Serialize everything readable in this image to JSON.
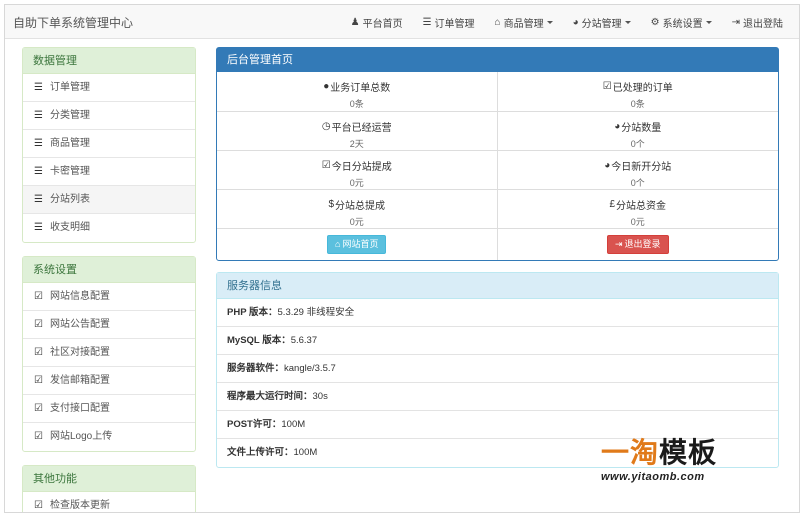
{
  "navbar": {
    "brand": "自助下单系统管理中心",
    "items": [
      {
        "label": "平台首页",
        "icon": "user-icon",
        "glyph": "♟",
        "dropdown": false
      },
      {
        "label": "订单管理",
        "icon": "list-icon",
        "glyph": "☰",
        "dropdown": false
      },
      {
        "label": "商品管理",
        "icon": "cart-icon",
        "glyph": "⌂",
        "dropdown": true
      },
      {
        "label": "分站管理",
        "icon": "globe-icon",
        "glyph": "◕",
        "dropdown": true
      },
      {
        "label": "系统设置",
        "icon": "gear-icon",
        "glyph": "⚙",
        "dropdown": true
      },
      {
        "label": "退出登陆",
        "icon": "logout-icon",
        "glyph": "⇥",
        "dropdown": false
      }
    ]
  },
  "sidebar": {
    "groups": [
      {
        "title": "数据管理",
        "items": [
          {
            "label": "订单管理",
            "glyph": "☰"
          },
          {
            "label": "分类管理",
            "glyph": "☰"
          },
          {
            "label": "商品管理",
            "glyph": "☰"
          },
          {
            "label": "卡密管理",
            "glyph": "☰"
          },
          {
            "label": "分站列表",
            "glyph": "☰"
          },
          {
            "label": "收支明细",
            "glyph": "☰"
          }
        ]
      },
      {
        "title": "系统设置",
        "items": [
          {
            "label": "网站信息配置",
            "glyph": "☑"
          },
          {
            "label": "网站公告配置",
            "glyph": "☑"
          },
          {
            "label": "社区对接配置",
            "glyph": "☑"
          },
          {
            "label": "发信邮箱配置",
            "glyph": "☑"
          },
          {
            "label": "支付接口配置",
            "glyph": "☑"
          },
          {
            "label": "网站Logo上传",
            "glyph": "☑"
          }
        ]
      },
      {
        "title": "其他功能",
        "items": [
          {
            "label": "检查版本更新",
            "glyph": "☑"
          }
        ]
      }
    ]
  },
  "dashboard": {
    "title": "后台管理首页",
    "stats": [
      {
        "label": "业务订单总数",
        "value": "0条",
        "glyph": "●"
      },
      {
        "label": "已处理的订单",
        "value": "0条",
        "glyph": "☑"
      },
      {
        "label": "平台已经运营",
        "value": "2天",
        "glyph": "◷"
      },
      {
        "label": "分站数量",
        "value": "0个",
        "glyph": "◕"
      },
      {
        "label": "今日分站提成",
        "value": "0元",
        "glyph": "☑"
      },
      {
        "label": "今日新开分站",
        "value": "0个",
        "glyph": "◕"
      },
      {
        "label": "分站总提成",
        "value": "0元",
        "glyph": "$"
      },
      {
        "label": "分站总资金",
        "value": "0元",
        "glyph": "£"
      }
    ],
    "home_button": "网站首页",
    "logout_button": "退出登录"
  },
  "server": {
    "title": "服务器信息",
    "rows": [
      {
        "label": "PHP 版本：",
        "value": "5.3.29 非线程安全"
      },
      {
        "label": "MySQL 版本：",
        "value": "5.6.37"
      },
      {
        "label": "服务器软件：",
        "value": "kangle/3.5.7"
      },
      {
        "label": "程序最大运行时间：",
        "value": "30s"
      },
      {
        "label": "POST许可：",
        "value": "100M"
      },
      {
        "label": "文件上传许可：",
        "value": "100M"
      }
    ]
  },
  "watermark": {
    "part1": "一淘",
    "part2": "模板",
    "url": "www.yitaomb.com"
  },
  "colors": {
    "primary": "#337ab7",
    "success_bg": "#dff0d8",
    "info_bg": "#d9edf7",
    "btn_info": "#5bc0de",
    "btn_danger": "#d9534f"
  }
}
